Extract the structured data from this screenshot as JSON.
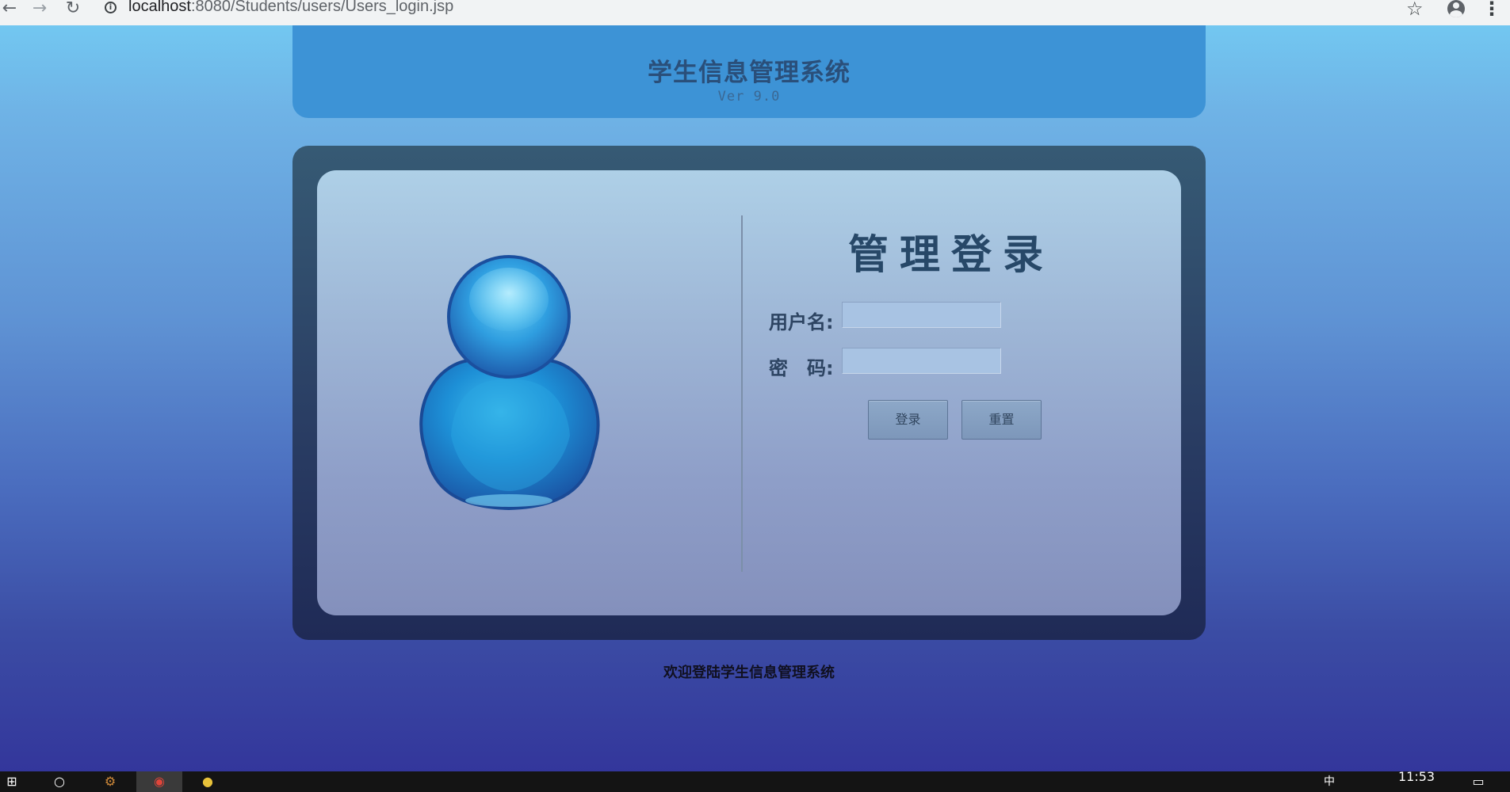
{
  "browser": {
    "url_host": "localhost",
    "url_path": ":8080/Students/users/Users_login.jsp",
    "back_icon": "←",
    "forward_icon": "→",
    "reload_icon": "↻",
    "info_icon": "i",
    "star_icon": "☆",
    "menu_icon": "⋮"
  },
  "header": {
    "title": "学生信息管理系统",
    "version": "Ver 9.0"
  },
  "login": {
    "title": "管理登录",
    "username_label": "用户名:",
    "password_label": "密　码:",
    "username_value": "",
    "password_value": "",
    "login_button": "登录",
    "reset_button": "重置"
  },
  "footer": {
    "welcome": "欢迎登陆学生信息管理系统"
  },
  "taskbar": {
    "clock": "11:53",
    "start_icon": "⊞",
    "search_icon": "○",
    "settings_icon": "⚙",
    "chrome_icon": "◉",
    "app_icon": "●",
    "ime_label": "中",
    "notification_icon": "▭"
  }
}
